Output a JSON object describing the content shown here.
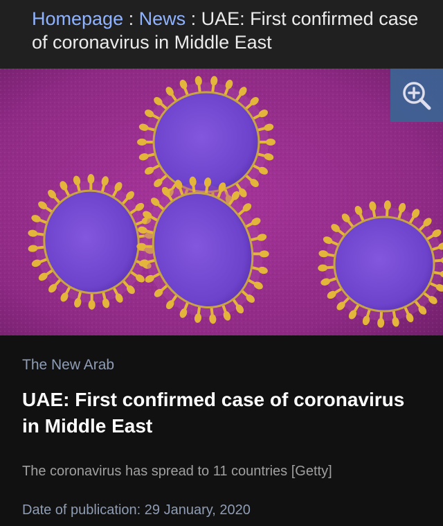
{
  "breadcrumb": {
    "items": [
      {
        "label": "Homepage"
      },
      {
        "label": "News"
      }
    ],
    "separator": " : ",
    "current": "UAE: First confirmed case of coronavirus in Middle East"
  },
  "hero": {
    "zoom_icon": "zoom-in-icon"
  },
  "article": {
    "source": "The New Arab",
    "headline": "UAE: First confirmed case of coronavirus in Middle East",
    "caption": "The coronavirus has spread to 11 countries [Getty]",
    "date": "Date of publication: 29 January, 2020"
  },
  "colors": {
    "link": "#8fb3ff",
    "meta": "#8f9db5",
    "image_background": "#8e2a84",
    "virus_body": "#7a4fd6",
    "virus_spikes": "#e3b53a",
    "zoom_button": "#3c6494"
  }
}
